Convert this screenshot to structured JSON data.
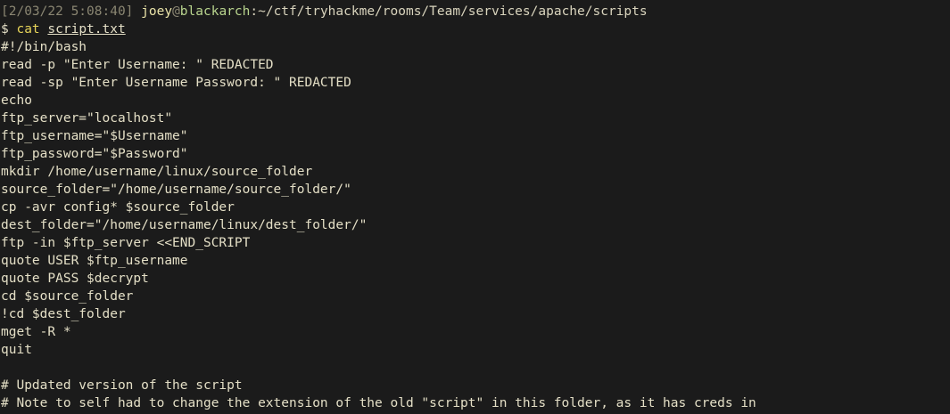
{
  "prompt": {
    "timestamp": "[2/03/22 5:08:40]",
    "user": "joey",
    "at": "@",
    "host": "blackarch",
    "path": ":~/ctf/tryhackme/rooms/Team/services/apache/scripts",
    "symbol": "$ ",
    "command": "cat",
    "argument": "script.txt"
  },
  "output": [
    "#!/bin/bash",
    "read -p \"Enter Username: \" REDACTED",
    "read -sp \"Enter Username Password: \" REDACTED",
    "echo",
    "ftp_server=\"localhost\"",
    "ftp_username=\"$Username\"",
    "ftp_password=\"$Password\"",
    "mkdir /home/username/linux/source_folder",
    "source_folder=\"/home/username/source_folder/\"",
    "cp -avr config* $source_folder",
    "dest_folder=\"/home/username/linux/dest_folder/\"",
    "ftp -in $ftp_server <<END_SCRIPT",
    "quote USER $ftp_username",
    "quote PASS $decrypt",
    "cd $source_folder",
    "!cd $dest_folder",
    "mget -R *",
    "quit",
    "",
    "# Updated version of the script",
    "# Note to self had to change the extension of the old \"script\" in this folder, as it has creds in"
  ],
  "colors": {
    "background": "#1b1b1b",
    "foreground": "#e4dfc6",
    "timestamp": "#8a8672",
    "user": "#e9e3a8",
    "host": "#b9d58e",
    "command": "#e8d55a"
  }
}
